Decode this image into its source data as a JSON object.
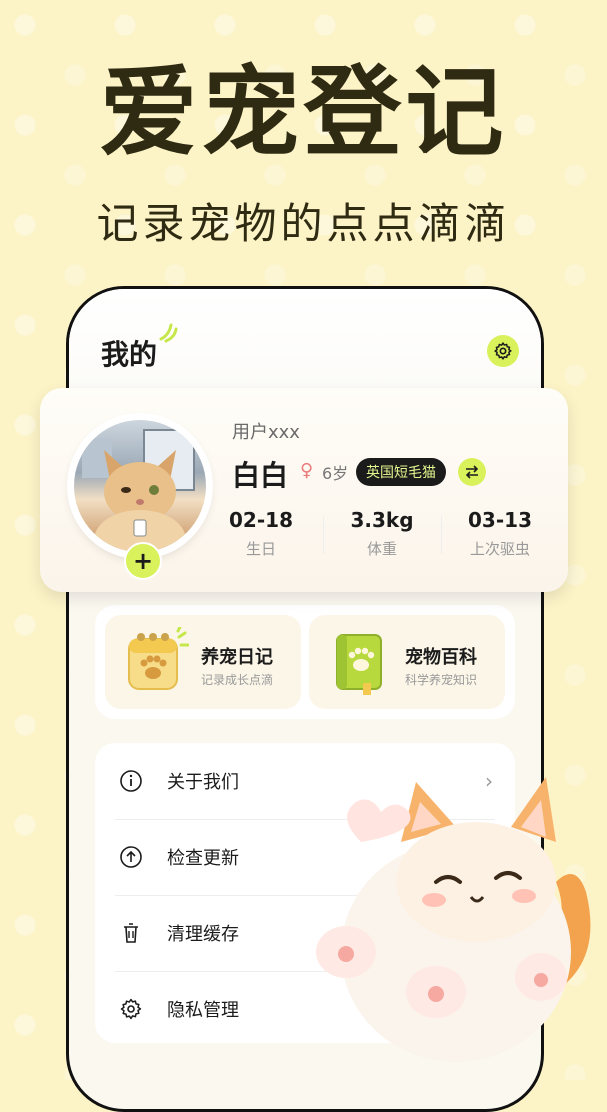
{
  "promo": {
    "headline": "爱宠登记",
    "subline": "记录宠物的点点滴滴"
  },
  "header": {
    "title": "我的",
    "settings_icon": "gear-icon"
  },
  "profile": {
    "username": "用户xxx",
    "pet_name": "白白",
    "gender_icon": "female-icon",
    "age": "6岁",
    "breed": "英国短毛猫",
    "swap_icon": "swap-icon",
    "add_icon": "plus-icon",
    "stats": [
      {
        "value": "02-18",
        "label": "生日"
      },
      {
        "value": "3.3kg",
        "label": "体重"
      },
      {
        "value": "03-13",
        "label": "上次驱虫"
      }
    ]
  },
  "features": [
    {
      "title": "养宠日记",
      "subtitle": "记录成长点滴",
      "icon": "calendar-paw-icon"
    },
    {
      "title": "宠物百科",
      "subtitle": "科学养宠知识",
      "icon": "book-paw-icon"
    }
  ],
  "menu": [
    {
      "label": "关于我们",
      "icon": "info-icon",
      "arrow": "›"
    },
    {
      "label": "检查更新",
      "icon": "update-icon",
      "arrow": ""
    },
    {
      "label": "清理缓存",
      "icon": "trash-icon",
      "arrow": ""
    },
    {
      "label": "隐私管理",
      "icon": "privacy-gear-icon",
      "arrow": ""
    }
  ],
  "colors": {
    "background": "#fcf3c7",
    "accent": "#d9f25c",
    "text": "#1b1b1b"
  }
}
